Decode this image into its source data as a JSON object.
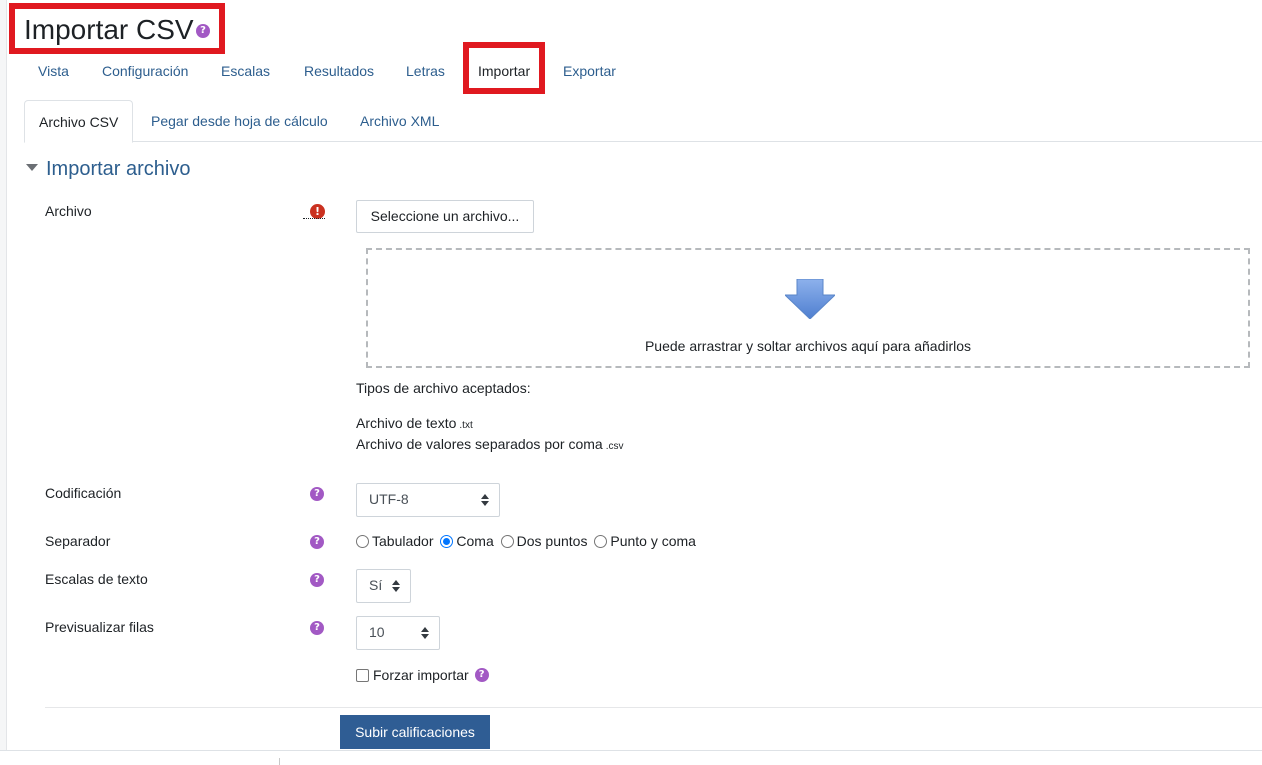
{
  "page": {
    "title": "Importar CSV",
    "help_glyph": "?"
  },
  "nav": {
    "items": [
      {
        "label": "Vista"
      },
      {
        "label": "Configuración"
      },
      {
        "label": "Escalas"
      },
      {
        "label": "Resultados"
      },
      {
        "label": "Letras"
      },
      {
        "label": "Importar",
        "active": true
      },
      {
        "label": "Exportar"
      }
    ]
  },
  "tabs": {
    "items": [
      {
        "label": "Archivo CSV",
        "active": true
      },
      {
        "label": "Pegar desde hoja de cálculo"
      },
      {
        "label": "Archivo XML"
      }
    ]
  },
  "section": {
    "title": "Importar archivo"
  },
  "form": {
    "file": {
      "label": "Archivo",
      "required_glyph": "!",
      "button_label": "Seleccione un archivo...",
      "dropzone_text": "Puede arrastrar y soltar archivos aquí para añadirlos",
      "accepted_title": "Tipos de archivo aceptados:",
      "accepted_types": [
        {
          "name": "Archivo de texto",
          "ext": ".txt"
        },
        {
          "name": "Archivo de valores separados por coma",
          "ext": ".csv"
        }
      ]
    },
    "encoding": {
      "label": "Codificación",
      "value": "UTF-8"
    },
    "separator": {
      "label": "Separador",
      "options": [
        {
          "label": "Tabulador",
          "checked": false
        },
        {
          "label": "Coma",
          "checked": true
        },
        {
          "label": "Dos puntos",
          "checked": false
        },
        {
          "label": "Punto y coma",
          "checked": false
        }
      ]
    },
    "text_scales": {
      "label": "Escalas de texto",
      "value": "Sí"
    },
    "preview_rows": {
      "label": "Previsualizar filas",
      "value": "10"
    },
    "force_import": {
      "label": "Forzar importar",
      "checked": false
    },
    "submit_label": "Subir calificaciones"
  },
  "colors": {
    "highlight": "#e01920",
    "link": "#2d5e8e",
    "help_icon": "#a259c4",
    "required_icon": "#ca3120",
    "primary_button": "#2f5d94",
    "arrow": "#6f9ae0"
  },
  "icons": {
    "title_help": "question-circle-icon",
    "required": "exclamation-circle-icon",
    "dropzone_arrow": "arrow-down-icon",
    "section_toggle": "caret-down-icon"
  }
}
